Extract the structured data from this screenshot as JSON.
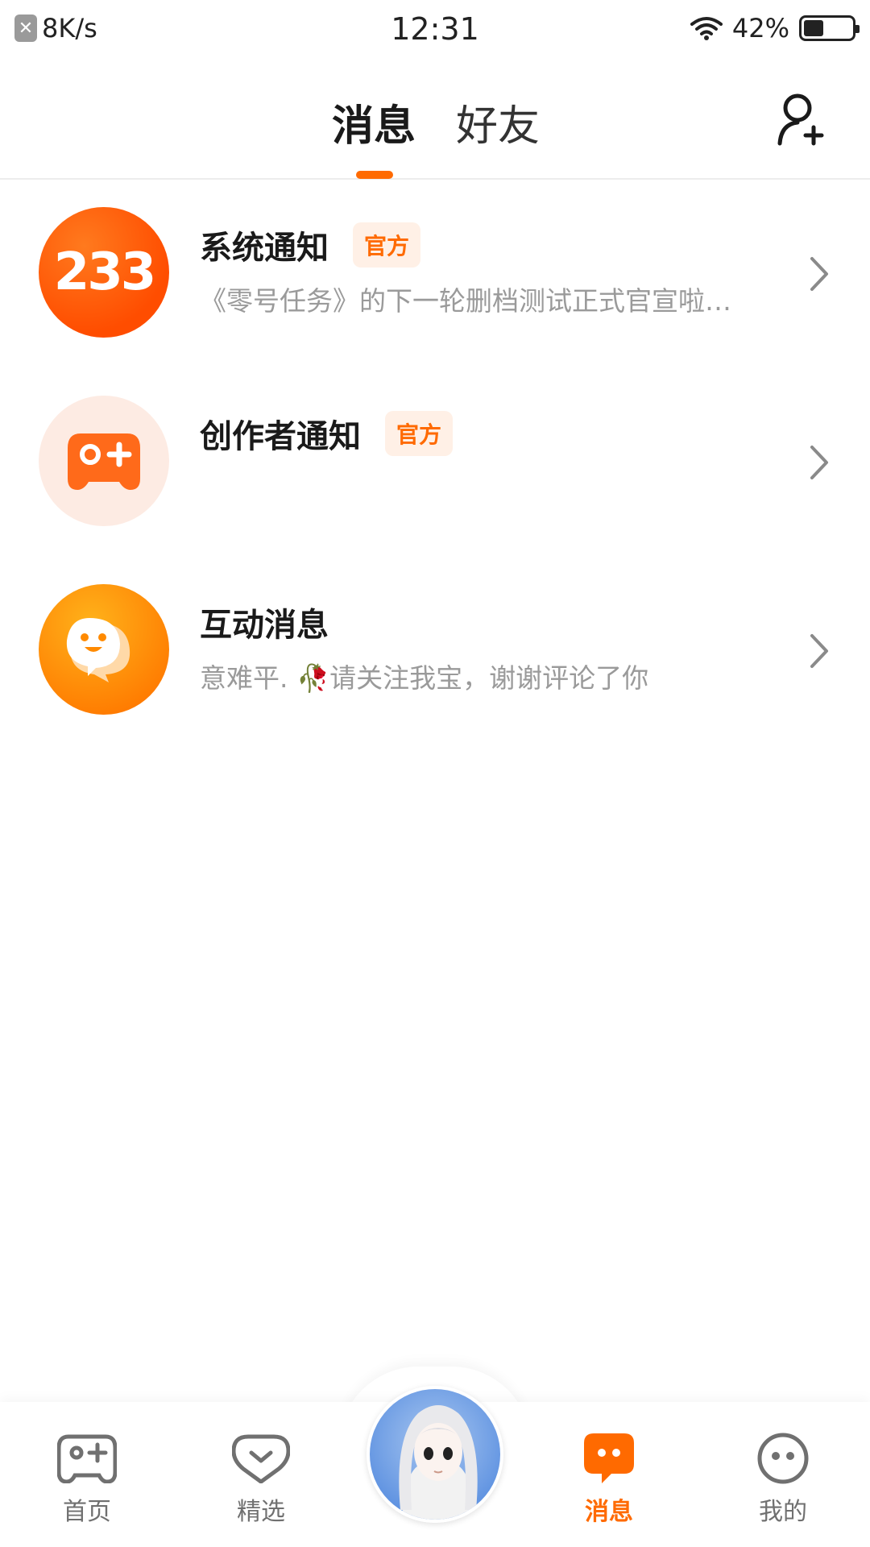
{
  "status_bar": {
    "net_speed": "8K/s",
    "time": "12:31",
    "battery_text": "42%",
    "battery_level": 0.42
  },
  "header": {
    "tabs": [
      {
        "label": "消息",
        "active": true
      },
      {
        "label": "好友",
        "active": false
      }
    ]
  },
  "messages": [
    {
      "title": "系统通知",
      "badge": "官方",
      "avatar_text": "233",
      "subtitle": "《零号任务》的下一轮删档测试正式官宣啦…"
    },
    {
      "title": "创作者通知",
      "badge": "官方",
      "subtitle": ""
    },
    {
      "title": "互动消息",
      "subtitle": "意难平.  🥀请关注我宝，谢谢评论了你"
    }
  ],
  "bottom_nav": [
    {
      "label": "首页",
      "icon": "gamepad-icon"
    },
    {
      "label": "精选",
      "icon": "heart-bubble-icon"
    },
    {
      "label": "消息",
      "icon": "message-icon",
      "active": true
    },
    {
      "label": "我的",
      "icon": "face-icon"
    }
  ],
  "colors": {
    "accent": "#ff6a00",
    "badge_bg": "#fff0e6",
    "muted_text": "#9a9a9a"
  }
}
